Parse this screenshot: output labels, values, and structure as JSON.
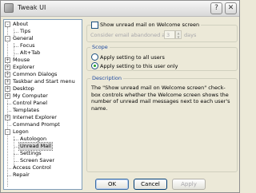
{
  "window": {
    "title": "Tweak UI",
    "help_glyph": "?",
    "close_glyph": "✕"
  },
  "tree": {
    "items": [
      {
        "label": "About",
        "expander": "-"
      },
      {
        "label": "Tips"
      },
      {
        "label": "General",
        "expander": "-"
      },
      {
        "label": "Focus"
      },
      {
        "label": "Alt+Tab"
      },
      {
        "label": "Mouse",
        "expander": "+"
      },
      {
        "label": "Explorer",
        "expander": "+"
      },
      {
        "label": "Common Dialogs",
        "expander": "+"
      },
      {
        "label": "Taskbar and Start menu",
        "expander": "+"
      },
      {
        "label": "Desktop",
        "expander": "+"
      },
      {
        "label": "My Computer",
        "expander": "+"
      },
      {
        "label": "Control Panel"
      },
      {
        "label": "Templates"
      },
      {
        "label": "Internet Explorer",
        "expander": "+"
      },
      {
        "label": "Command Prompt"
      },
      {
        "label": "Logon",
        "expander": "-"
      },
      {
        "label": "Autologon"
      },
      {
        "label": "Unread Mail",
        "selected": true
      },
      {
        "label": "Settings"
      },
      {
        "label": "Screen Saver"
      },
      {
        "label": "Access Control"
      },
      {
        "label": "Repair"
      }
    ]
  },
  "unread": {
    "show_label": "Show unread mail on Welcome screen",
    "show_checked": false,
    "abandoned_prefix": "Consider email abandoned after",
    "abandoned_value": "3",
    "abandoned_suffix": "days"
  },
  "scope": {
    "title": "Scope",
    "all_users": "Apply setting to all users",
    "this_user": "Apply setting to this user only",
    "selected": "this_user"
  },
  "description": {
    "title": "Description",
    "text": "The \"Show unread mail on Welcome screen\" check-box controls whether the Welcome screen shows the number of unread mail messages next to each user's name."
  },
  "buttons": {
    "ok": "OK",
    "cancel": "Cancel",
    "apply": "Apply"
  }
}
